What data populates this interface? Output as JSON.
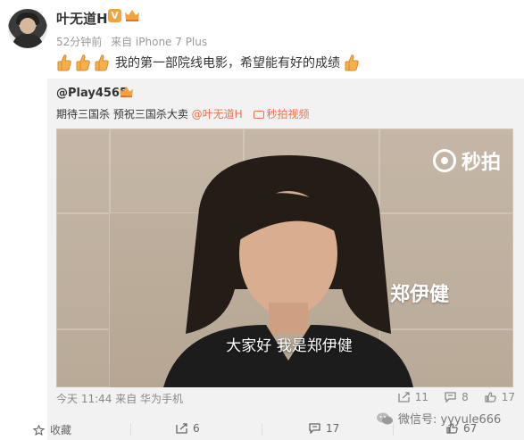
{
  "post": {
    "username": "叶无道H",
    "verified_badge": "V",
    "meta": {
      "time": "52分钟前",
      "source": "来自 iPhone 7 Plus"
    },
    "content_text": "我的第一部院线电影，希望能有好的成绩",
    "emoji": "thumbs-up-icon"
  },
  "repost": {
    "username": "@Play4565",
    "text": "期待三国杀 预祝三国杀大卖",
    "mention": "@叶无道H",
    "video_link": "秒拍视频",
    "video": {
      "watermark": "秒拍",
      "name_caption": "郑伊健",
      "subtitle": "大家好 我是郑伊健"
    },
    "footer": {
      "time": "今天 11:44 来自 华为手机",
      "reposts": "11",
      "comments": "8",
      "likes": "17"
    }
  },
  "bottom_bar": {
    "favorite_label": "收藏",
    "reposts": "6",
    "comments": "17",
    "likes": "67"
  },
  "watermark": "微信号: yyyule666",
  "colors": {
    "accent": "#eb7350",
    "badge": "#f3a33c",
    "repost_bg": "#f2f2f2"
  }
}
